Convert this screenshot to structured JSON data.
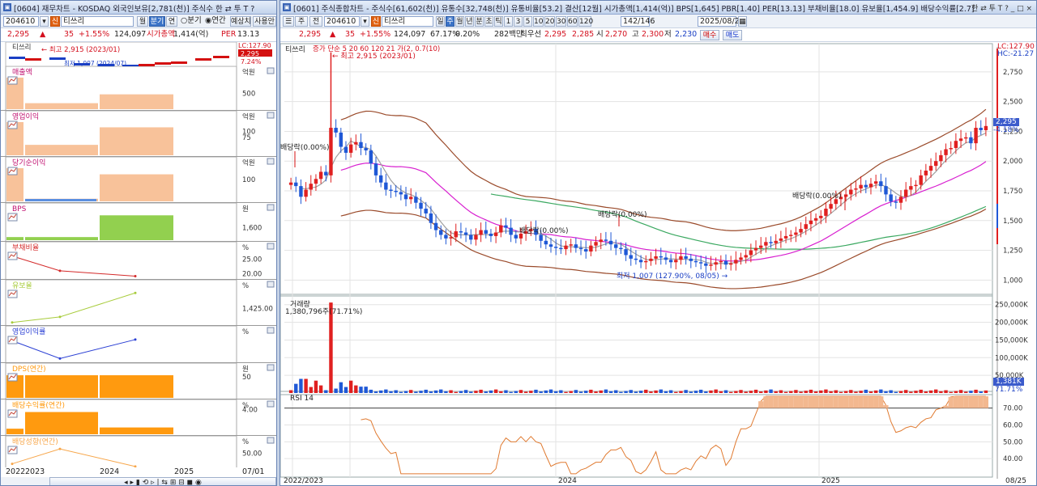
{
  "left": {
    "title": "[0604] 재무차트 - KOSDAQ 외국인보유[2,781(천)] 주식수 한 ⇄ 투 T ?",
    "code": "204610",
    "badge": "신",
    "name": "티쓰리",
    "btn_ju": "월",
    "btn_bungi": "분기",
    "btn_yeon": "연",
    "radio_bungi": "○분기",
    "radio_yeon": "◉연간",
    "ex_label": "예상치",
    "usage": "사용안",
    "price": "2,295",
    "arrow": "▲",
    "change": "35",
    "pct": "+1.55%",
    "volume": "124,097",
    "mcap_label": "시가총액",
    "mcap": "1,414(억)",
    "per_label": "PER",
    "per": "13.13",
    "mini": {
      "label": "티쓰리",
      "high": "← 최고 2,915 (2023/01)",
      "low": "최저 1,007 (2024/07)",
      "lc": "LC:127.90",
      "pricebox": "2,295",
      "pct": "7.24%"
    },
    "panels": [
      {
        "label": "매출액",
        "unit": "억원",
        "ticks": [
          "500"
        ],
        "color": "#f8c29a",
        "values": [
          1000,
          190,
          470,
          null
        ],
        "ymax": 1000,
        "ytickvals": [
          500
        ]
      },
      {
        "label": "영업이익",
        "unit": "억원",
        "ticks": [
          "100",
          "75"
        ],
        "color": "#f8c29a",
        "values": [
          140,
          44,
          118,
          null
        ],
        "ymax": 140,
        "ytickvals": [
          100,
          75
        ]
      },
      {
        "label": "당기순이익",
        "unit": "억원",
        "ticks": [
          "100"
        ],
        "color": "#f8c29a",
        "values": [
          152,
          12,
          124,
          null
        ],
        "ymax": 152,
        "ytickvals": [
          100
        ]
      },
      {
        "label": "BPS",
        "unit": "원",
        "ticks": [
          "1,600"
        ],
        "color": "#92d04f",
        "values": [
          1555,
          1555,
          1660,
          null
        ],
        "ymin": 1540,
        "ymax": 1665,
        "ytickvals": [
          1600
        ]
      },
      {
        "label": "부채비율",
        "unit": "%",
        "ticks": [
          "25.00",
          "20.00"
        ],
        "color": "#d42a2a",
        "values": [
          26.0,
          21.0,
          19.2,
          null
        ],
        "ymin": 18.5,
        "ymax": 27,
        "ytickvals": [
          25,
          20
        ],
        "kind": "line"
      },
      {
        "label": "유보율",
        "unit": "%",
        "ticks": [
          "1,425.00"
        ],
        "color": "#a8cc3c",
        "values": [
          1350,
          1380,
          1510,
          null
        ],
        "ymin": 1340,
        "ymax": 1520,
        "ytickvals": [
          1425
        ],
        "kind": "line"
      },
      {
        "label": "영업이익률",
        "unit": "%",
        "ticks": [],
        "color": "#2a3fd4",
        "values": [
          15.0,
          12.0,
          15.2,
          null
        ],
        "ymin": 11.5,
        "ymax": 15.6,
        "ytickvals": [],
        "kind": "line"
      },
      {
        "label": "DPS(연간)",
        "unit": "원",
        "ticks": [
          "50"
        ],
        "color": "#ff9a0f",
        "values": [
          54,
          54,
          54,
          null
        ],
        "ymin": 0,
        "ymax": 56,
        "ytickvals": [
          50
        ]
      },
      {
        "label": "배당수익률(연간)",
        "unit": "%",
        "ticks": [
          "4.00"
        ],
        "color": "#ff9a0f",
        "values": [
          0.9,
          3.6,
          1.1,
          null
        ],
        "ymin": 0,
        "ymax": 3.8,
        "ytickvals": [
          4
        ],
        "kind": "bar"
      },
      {
        "label": "배당성향(연간)",
        "unit": "%",
        "ticks": [
          "50.00"
        ],
        "color": "#f7a64a",
        "values": [
          38,
          55,
          35,
          null
        ],
        "ymin": 33,
        "ymax": 57,
        "ytickvals": [
          50
        ],
        "kind": "line"
      }
    ],
    "xlabels": [
      "2022",
      "2023",
      "2024",
      "2025"
    ],
    "xdate": "07/01"
  },
  "right": {
    "title": "[0601] 주식종합차트 - 주식수[61,602(천)] 유통수[32,748(천)] 유통비율[53.2] 결산[12월] 시가총액[1,414(억)] BPS[1,645] PBR[1.40] PER[13.13] 부채비율[18.0] 유보율[1,454.9] 배당수익률[2.7]",
    "code_label": "주",
    "code_label2": "전",
    "code": "204610",
    "badge": "신",
    "name": "티쓰리",
    "periods": [
      "일",
      "주",
      "월",
      "년",
      "분",
      "초",
      "틱",
      "1",
      "3",
      "5",
      "10",
      "20",
      "30",
      "60",
      "120"
    ],
    "selected_period": "주",
    "count": "142/146",
    "date": "2025/08/25",
    "price": "2,295",
    "arrow": "▲",
    "change": "35",
    "pct": "+1.55%",
    "volume": "124,097",
    "turnover": "67.17%",
    "vp": "0.20%",
    "amount": "282백만",
    "prev_close_label": "최우선",
    "ask": "2,295",
    "bid": "2,285",
    "open_label": "시",
    "open": "2,270",
    "high_label": "고",
    "high": "2,300",
    "low_label": "저",
    "low": "2,230",
    "buy": "매수",
    "sell": "매도",
    "chart_label": "티쓰리",
    "chart_overlay": "증가 단순 5 20 60 120 21 가(2, 0.7(10)",
    "high_ann": "← 최고 2,915 (2023/01)",
    "low_ann": "최저 1,007 (127.90%, 08/05) →",
    "div1": "배당락(0.00%)",
    "div2": "배당락(0.00%)",
    "div3": "배당락(0.00%)",
    "div4": "배당락(0.00%)",
    "lc": "LC:127.90",
    "hc": "HC:-21.27",
    "pricebox": "2,295",
    "pricebox_pct": "-4.18%",
    "vol_label": "거래량",
    "vol_ann": "1,380,796주(71.71%)",
    "vol_box": "1,381K",
    "vol_pct": "71.71%",
    "rsi_label": "RSI 14",
    "xlabels": [
      "2022/2023",
      "2024",
      "2025"
    ],
    "xdate": "08/25"
  },
  "chart_data": [
    {
      "type": "candlestick",
      "title": "티쓰리",
      "y_ticks": [
        1000,
        1250,
        1500,
        1750,
        2000,
        2250,
        2500,
        2750
      ],
      "ylim": [
        880,
        2960
      ],
      "x_start": "2022/12",
      "x_end": "2025/08",
      "close_last": 2295,
      "high_marker": {
        "value": 2915,
        "date": "2023/01"
      },
      "low_marker": {
        "value": 1007,
        "date": "2024/07"
      },
      "series_close": [
        1820,
        1790,
        1700,
        1760,
        1810,
        1850,
        1910,
        1880,
        2280,
        2240,
        2120,
        2070,
        2140,
        2160,
        2110,
        2090,
        1980,
        1880,
        1820,
        1760,
        1750,
        1740,
        1720,
        1680,
        1700,
        1650,
        1600,
        1560,
        1480,
        1420,
        1380,
        1350,
        1360,
        1410,
        1400,
        1380,
        1340,
        1380,
        1420,
        1390,
        1370,
        1400,
        1460,
        1440,
        1380,
        1350,
        1390,
        1410,
        1430,
        1380,
        1330,
        1300,
        1280,
        1270,
        1260,
        1290,
        1300,
        1270,
        1260,
        1240,
        1290,
        1320,
        1340,
        1330,
        1300,
        1270,
        1260,
        1210,
        1180,
        1170,
        1150,
        1160,
        1180,
        1200,
        1190,
        1170,
        1150,
        1170,
        1200,
        1180,
        1160,
        1150,
        1140,
        1120,
        1130,
        1150,
        1160,
        1130,
        1140,
        1170,
        1190,
        1210,
        1250,
        1270,
        1290,
        1320,
        1310,
        1330,
        1350,
        1370,
        1380,
        1400,
        1430,
        1470,
        1500,
        1520,
        1540,
        1600,
        1640,
        1680,
        1700,
        1720,
        1760,
        1770,
        1800,
        1780,
        1810,
        1830,
        1790,
        1720,
        1660,
        1650,
        1700,
        1760,
        1790,
        1800,
        1880,
        1920,
        1960,
        2000,
        2050,
        2100,
        2110,
        2170,
        2190,
        2200,
        2150,
        2280,
        2260,
        2295
      ]
    },
    {
      "type": "bar",
      "title": "거래량",
      "y_ticks": [
        "50,000K",
        "100,000K",
        "150,000K",
        "200,000K",
        "250,000K"
      ],
      "ylim": [
        0,
        270000
      ],
      "max_bar_value": 256000
    },
    {
      "type": "line",
      "title": "RSI 14",
      "y_ticks": [
        40,
        50,
        60,
        70
      ],
      "ylim": [
        30,
        78
      ],
      "guide": 70
    }
  ]
}
